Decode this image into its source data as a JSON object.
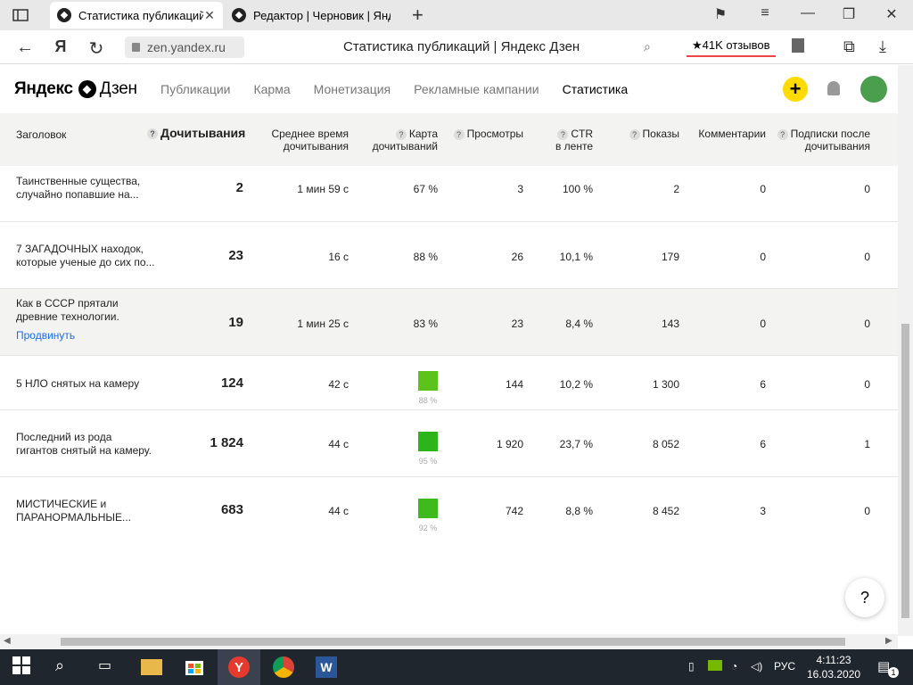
{
  "browser": {
    "tabs": [
      {
        "label": "Статистика публикаций"
      },
      {
        "label": "Редактор | Черновик | Янд"
      }
    ],
    "url": "zen.yandex.ru",
    "page_title": "Статистика публикаций | Яндекс Дзен",
    "reviews_label": "★41K отзывов"
  },
  "site": {
    "logo_yandex": "Яндекс",
    "logo_zen": "Дзен",
    "nav": [
      "Публикации",
      "Карма",
      "Монетизация",
      "Рекламные кампании",
      "Статистика"
    ],
    "plus_label": "+"
  },
  "table": {
    "headers": {
      "title": "Заголовок",
      "reads": "Дочитывания",
      "avg_time_1": "Среднее время",
      "avg_time_2": "дочитывания",
      "map_1": "Карта",
      "map_2": "дочитываний",
      "views": "Просмотры",
      "ctr_1": "CTR",
      "ctr_2": "в ленте",
      "shows": "Показы",
      "comments": "Комментарии",
      "subs_1": "Подписки после",
      "subs_2": "дочитывания"
    },
    "rows": [
      {
        "title1": "Таинственные существа,",
        "title2": "случайно попавшие на...",
        "reads": "2",
        "avg": "1 мин 59 с",
        "map": "67 %",
        "views": "3",
        "ctr": "100 %",
        "shows": "2",
        "comments": "0",
        "subs": "0"
      },
      {
        "title1": "7 ЗАГАДОЧНЫХ находок,",
        "title2": "которые ученые до сих по...",
        "reads": "23",
        "avg": "16 с",
        "map": "88 %",
        "views": "26",
        "ctr": "10,1 %",
        "shows": "179",
        "comments": "0",
        "subs": "0"
      },
      {
        "title1": "Как в СССР прятали",
        "title2": "древние технологии.",
        "promo": "Продвинуть",
        "reads": "19",
        "avg": "1 мин 25 с",
        "map": "83 %",
        "views": "23",
        "ctr": "8,4 %",
        "shows": "143",
        "comments": "0",
        "subs": "0"
      },
      {
        "title1": "5 НЛО снятых на камеру",
        "title2": "",
        "reads": "124",
        "avg": "42 с",
        "map": "88 %",
        "views": "144",
        "ctr": "10,2 %",
        "shows": "1 300",
        "comments": "6",
        "subs": "0"
      },
      {
        "title1": "Последний из рода",
        "title2": "гигантов снятый на камеру.",
        "reads": "1 824",
        "avg": "44 с",
        "map": "95 %",
        "views": "1 920",
        "ctr": "23,7 %",
        "shows": "8 052",
        "comments": "6",
        "subs": "1"
      },
      {
        "title1": "МИСТИЧЕСКИЕ и",
        "title2": "ПАРАНОРМАЛЬНЫЕ...",
        "reads": "683",
        "avg": "44 с",
        "map": "92 %",
        "views": "742",
        "ctr": "8,8 %",
        "shows": "8 452",
        "comments": "3",
        "subs": "0"
      }
    ]
  },
  "help_label": "?",
  "taskbar": {
    "lang": "РУС",
    "time": "4:11:23",
    "date": "16.03.2020",
    "notif_count": "1"
  },
  "colors": {
    "accent_yellow": "#ffdb00",
    "link_blue": "#1a6fe6",
    "map_green_light": "#5cc21c",
    "map_green": "#2bb51b",
    "map_green_mid": "#3fba1d"
  }
}
